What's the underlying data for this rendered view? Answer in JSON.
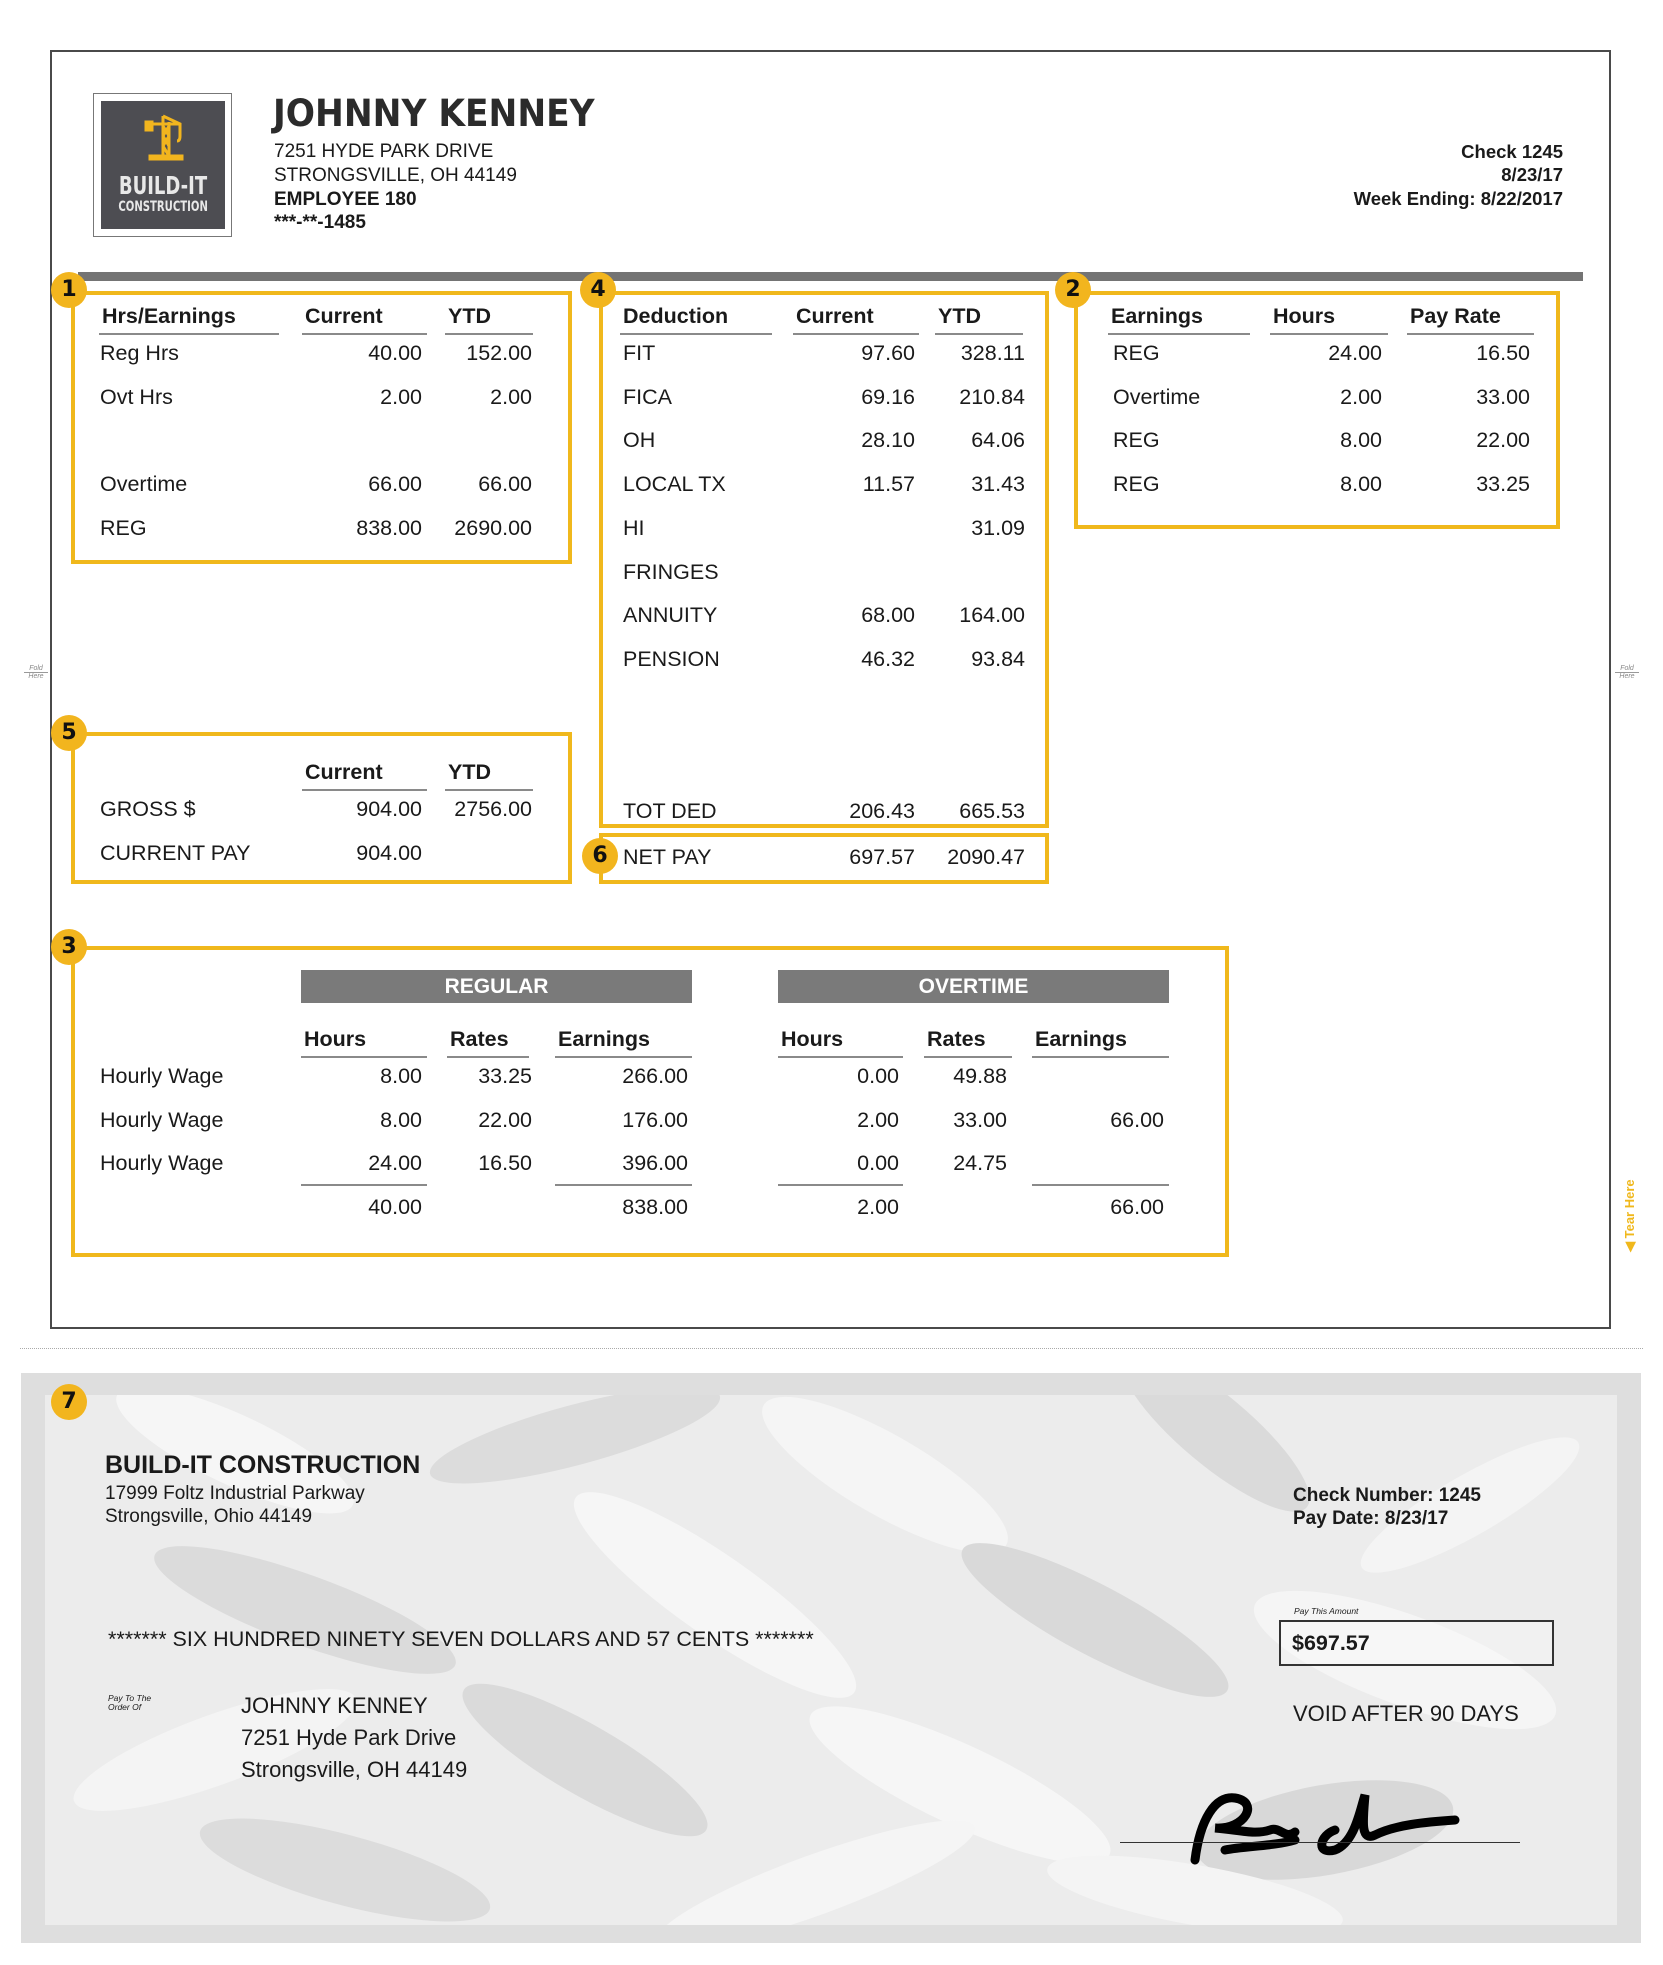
{
  "stub": {
    "logo": {
      "line1": "BUILD-IT",
      "line2": "CONSTRUCTION",
      "icon": "crane-icon"
    },
    "employee": {
      "name": "JOHNNY KENNEY",
      "address1": "7251 HYDE PARK DRIVE",
      "address2": "STRONGSVILLE, OH 44149",
      "employee_id": "EMPLOYEE 180",
      "ssn_masked": "***-**-1485"
    },
    "check_info": {
      "check": "Check 1245",
      "date": "8/23/17",
      "week_ending": "Week Ending: 8/22/2017"
    },
    "fold_label": {
      "line1": "Fold",
      "line2": "Here"
    },
    "tear_label": "Tear Here",
    "badge_color": "#F2B51E",
    "box_color": "#F0B81C"
  },
  "section1": {
    "badge": "1",
    "headers": [
      "Hrs/Earnings",
      "Current",
      "YTD"
    ],
    "rows": [
      {
        "label": "Reg Hrs",
        "current": "40.00",
        "ytd": "152.00"
      },
      {
        "label": "Ovt Hrs",
        "current": "2.00",
        "ytd": "2.00"
      },
      {
        "label": "",
        "current": "",
        "ytd": ""
      },
      {
        "label": "Overtime",
        "current": "66.00",
        "ytd": "66.00"
      },
      {
        "label": "REG",
        "current": "838.00",
        "ytd": "2690.00"
      }
    ]
  },
  "section4": {
    "badge": "4",
    "headers": [
      "Deduction",
      "Current",
      "YTD"
    ],
    "rows": [
      {
        "label": "FIT",
        "current": "97.60",
        "ytd": "328.11"
      },
      {
        "label": "FICA",
        "current": "69.16",
        "ytd": "210.84"
      },
      {
        "label": "OH",
        "current": "28.10",
        "ytd": "64.06"
      },
      {
        "label": "LOCAL TX",
        "current": "11.57",
        "ytd": "31.43"
      },
      {
        "label": "HI",
        "current": "",
        "ytd": "31.09"
      },
      {
        "label": "FRINGES",
        "current": "",
        "ytd": ""
      },
      {
        "label": "ANNUITY",
        "current": "68.00",
        "ytd": "164.00"
      },
      {
        "label": "PENSION",
        "current": "46.32",
        "ytd": "93.84"
      }
    ],
    "total": {
      "label": "TOT DED",
      "current": "206.43",
      "ytd": "665.53"
    }
  },
  "section6": {
    "badge": "6",
    "label": "NET PAY",
    "current": "697.57",
    "ytd": "2090.47"
  },
  "section2": {
    "badge": "2",
    "headers": [
      "Earnings",
      "Hours",
      "Pay Rate"
    ],
    "rows": [
      {
        "label": "REG",
        "hours": "24.00",
        "rate": "16.50"
      },
      {
        "label": "Overtime",
        "hours": "2.00",
        "rate": "33.00"
      },
      {
        "label": "REG",
        "hours": "8.00",
        "rate": "22.00"
      },
      {
        "label": "REG",
        "hours": "8.00",
        "rate": "33.25"
      }
    ]
  },
  "section5": {
    "badge": "5",
    "headers": [
      "Current",
      "YTD"
    ],
    "rows": [
      {
        "label": "GROSS $",
        "current": "904.00",
        "ytd": "2756.00"
      },
      {
        "label": "CURRENT PAY",
        "current": "904.00",
        "ytd": ""
      }
    ]
  },
  "section3": {
    "badge": "3",
    "regular_title": "REGULAR",
    "overtime_title": "OVERTIME",
    "headers": [
      "Hours",
      "Rates",
      "Earnings"
    ],
    "rows": [
      {
        "label": "Hourly Wage",
        "reg_hours": "8.00",
        "reg_rate": "33.25",
        "reg_earn": "266.00",
        "ot_hours": "0.00",
        "ot_rate": "49.88",
        "ot_earn": ""
      },
      {
        "label": "Hourly Wage",
        "reg_hours": "8.00",
        "reg_rate": "22.00",
        "reg_earn": "176.00",
        "ot_hours": "2.00",
        "ot_rate": "33.00",
        "ot_earn": "66.00"
      },
      {
        "label": "Hourly Wage",
        "reg_hours": "24.00",
        "reg_rate": "16.50",
        "reg_earn": "396.00",
        "ot_hours": "0.00",
        "ot_rate": "24.75",
        "ot_earn": ""
      }
    ],
    "totals": {
      "reg_hours": "40.00",
      "reg_earn": "838.00",
      "ot_hours": "2.00",
      "ot_earn": "66.00"
    }
  },
  "check": {
    "badge": "7",
    "company": "BUILD-IT CONSTRUCTION",
    "company_address1": "17999 Foltz Industrial Parkway",
    "company_address2": "Strongsville, Ohio 44149",
    "check_number": "Check Number:  1245",
    "pay_date": "Pay Date:  8/23/17",
    "amount_words": "******* SIX HUNDRED NINETY SEVEN DOLLARS AND 57 CENTS *******",
    "pay_this_amount_label": "Pay This Amount",
    "amount": "$697.57",
    "void_notice": "VOID AFTER 90 DAYS",
    "pay_to_label1": "Pay To The",
    "pay_to_label2": "Order Of",
    "payee_name": "JOHNNY KENNEY",
    "payee_address1": "7251 Hyde Park Drive",
    "payee_address2": "Strongsville, OH 44149",
    "signature": "signature-image"
  }
}
